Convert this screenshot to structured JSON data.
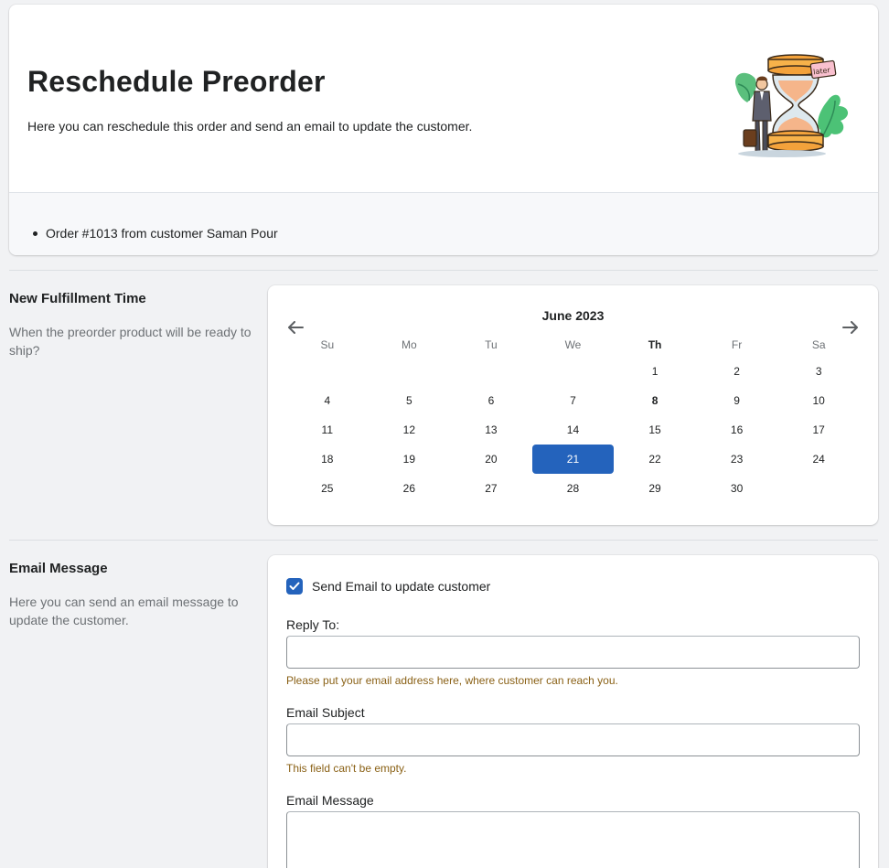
{
  "header": {
    "title": "Reschedule Preorder",
    "subtitle": "Here you can reschedule this order and send an email to update the customer.",
    "order_info": "Order #1013 from customer Saman Pour",
    "illustration_tag": "later"
  },
  "fulfillment": {
    "title": "New Fulfillment Time",
    "description": "When the preorder product will be ready to ship?"
  },
  "calendar": {
    "month_label": "June 2023",
    "weekdays": [
      "Su",
      "Mo",
      "Tu",
      "We",
      "Th",
      "Fr",
      "Sa"
    ],
    "bold_weekday": "Th",
    "weeks": [
      [
        "",
        "",
        "",
        "",
        "1",
        "2",
        "3"
      ],
      [
        "4",
        "5",
        "6",
        "7",
        "8",
        "9",
        "10"
      ],
      [
        "11",
        "12",
        "13",
        "14",
        "15",
        "16",
        "17"
      ],
      [
        "18",
        "19",
        "20",
        "21",
        "22",
        "23",
        "24"
      ],
      [
        "25",
        "26",
        "27",
        "28",
        "29",
        "30",
        ""
      ]
    ],
    "today": "8",
    "selected": "21",
    "accent_color": "#2463bc"
  },
  "email": {
    "title": "Email Message",
    "description": "Here you can send an email message to update the customer.",
    "checkbox_label": "Send Email to update customer",
    "checkbox_checked": true,
    "reply_to_label": "Reply To:",
    "reply_to_value": "",
    "reply_to_help": "Please put your email address here, where customer can reach you.",
    "subject_label": "Email Subject",
    "subject_value": "",
    "subject_error": "This field can't be empty.",
    "message_label": "Email Message",
    "message_value": ""
  }
}
